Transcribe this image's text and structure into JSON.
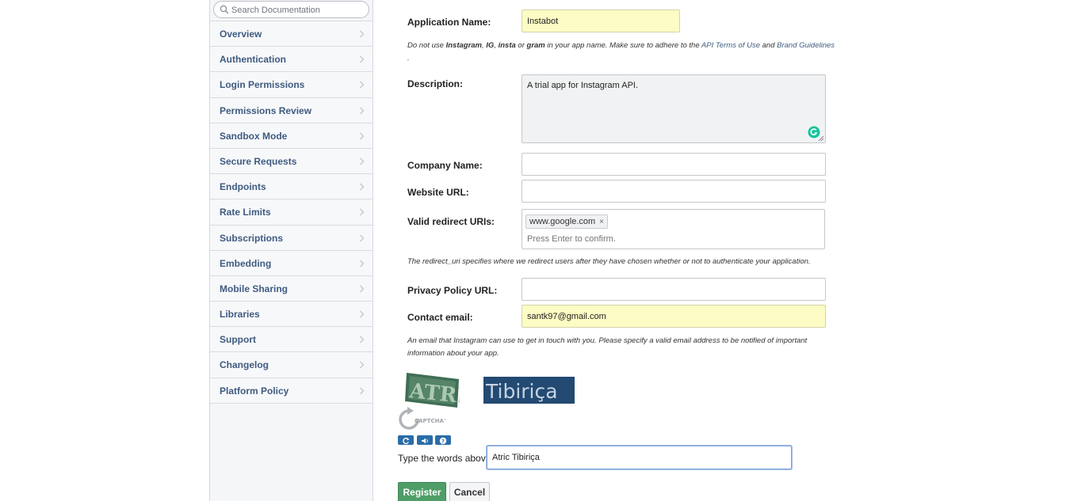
{
  "sidebar": {
    "search_placeholder": "Search Documentation",
    "items": [
      {
        "label": "Overview"
      },
      {
        "label": "Authentication"
      },
      {
        "label": "Login Permissions"
      },
      {
        "label": "Permissions Review"
      },
      {
        "label": "Sandbox Mode"
      },
      {
        "label": "Secure Requests"
      },
      {
        "label": "Endpoints"
      },
      {
        "label": "Rate Limits"
      },
      {
        "label": "Subscriptions"
      },
      {
        "label": "Embedding"
      },
      {
        "label": "Mobile Sharing"
      },
      {
        "label": "Libraries"
      },
      {
        "label": "Support"
      },
      {
        "label": "Changelog"
      },
      {
        "label": "Platform Policy"
      }
    ]
  },
  "form": {
    "app_name": {
      "label": "Application Name:",
      "value": "Instabot"
    },
    "name_note": {
      "prefix": "Do not use ",
      "w1": "Instagram",
      "sep1": ", ",
      "w2": "IG",
      "sep2": ", ",
      "w3": "insta",
      "sep3": " or ",
      "w4": "gram",
      "mid": " in your app name. Make sure to adhere to the ",
      "link1": "API Terms of Use",
      "and": " and ",
      "link2": "Brand Guidelines",
      "end": "."
    },
    "description": {
      "label": "Description:",
      "value": "A trial app for Instagram API."
    },
    "company": {
      "label": "Company Name:",
      "value": ""
    },
    "website": {
      "label": "Website URL:",
      "value": ""
    },
    "redirect": {
      "label": "Valid redirect URIs:",
      "tag": "www.google.com",
      "tag_remove": "×",
      "placeholder": "Press Enter to confirm."
    },
    "redirect_note": "The redirect_uri specifies where we redirect users after they have chosen whether or not to authenticate your application.",
    "privacy": {
      "label": "Privacy Policy URL:",
      "value": ""
    },
    "contact": {
      "label": "Contact email:",
      "value": "santk97@gmail.com"
    },
    "contact_note": "An email that Instagram can use to get in touch with you. Please specify a valid email address to be notified of important information about your app."
  },
  "captcha": {
    "word1": "ATRIC",
    "word2": "Tibiriça",
    "logo_text": "CAPTCHA™",
    "prompt": "Type the words above:",
    "answer": "Atric Tibiriça",
    "icons": [
      "refresh-icon",
      "audio-icon",
      "help-icon"
    ]
  },
  "buttons": {
    "register": "Register",
    "cancel": "Cancel"
  },
  "colors": {
    "nav_text": "#3f5b80",
    "register": "#4f9e68",
    "autofill": "#fcfcc4",
    "link": "#3f5b80"
  }
}
